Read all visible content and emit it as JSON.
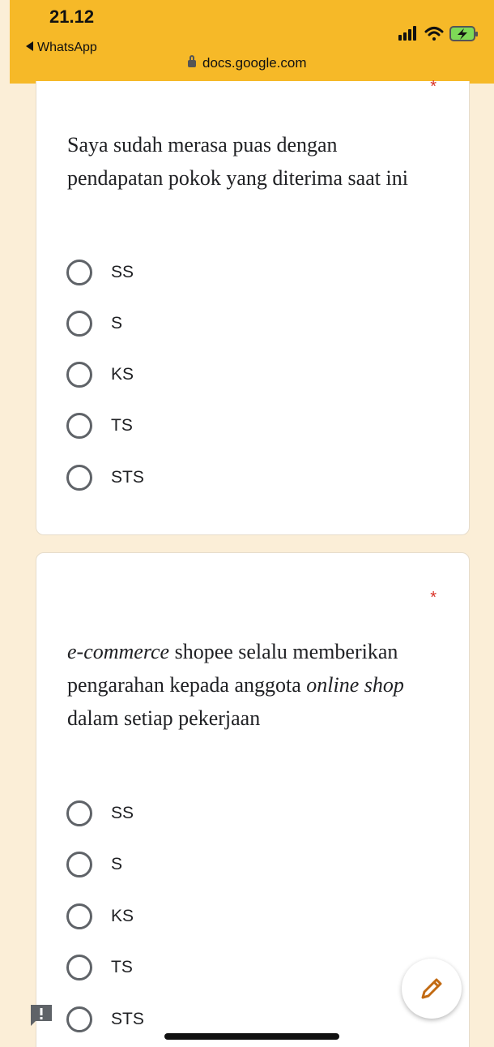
{
  "status_bar": {
    "time": "21.12",
    "back_app": "WhatsApp",
    "url": "docs.google.com",
    "icons": [
      "signal-icon",
      "wifi-icon",
      "battery-charging-icon"
    ],
    "bg_color": "#f6b928"
  },
  "questions": [
    {
      "text_parts": [
        {
          "text": "Saya sudah merasa puas dengan pendapatan pokok yang diterima saat ini",
          "italic": false
        }
      ],
      "required_mark": "*",
      "options": [
        "SS",
        "S",
        "KS",
        "TS",
        "STS"
      ]
    },
    {
      "text_parts": [
        {
          "text": "e-commerce",
          "italic": true
        },
        {
          "text": " shopee selalu memberikan pengarahan kepada anggota ",
          "italic": false
        },
        {
          "text": "online shop",
          "italic": true
        },
        {
          "text": " dalam setiap pekerjaan",
          "italic": false
        }
      ],
      "required_mark": "*",
      "options": [
        "SS",
        "S",
        "KS",
        "TS",
        "STS"
      ]
    }
  ],
  "fab": {
    "icon": "pencil-icon"
  },
  "report": {
    "icon": "report-icon"
  }
}
